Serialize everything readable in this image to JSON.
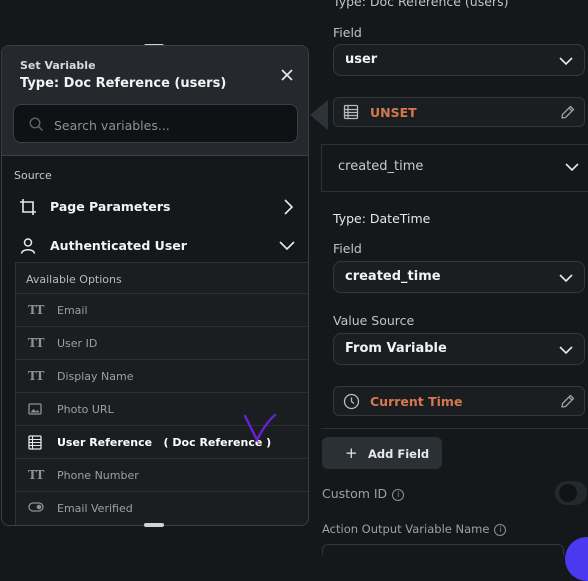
{
  "colors": {
    "accent": "#4b39ef",
    "unset": "#d6784e",
    "bg": "#14181b",
    "panel": "#1a1e21"
  },
  "right_panel": {
    "top_clipped_label": "Type: Doc Reference (users)",
    "field_label_1": "Field",
    "field_value_1": "user",
    "value_1": "UNSET",
    "section_title": "created_time",
    "type_label": "Type: DateTime",
    "field_label_2": "Field",
    "field_value_2": "created_time",
    "value_source_label": "Value Source",
    "value_source": "From Variable",
    "value_2": "Current Time",
    "add_field": "Add Field",
    "custom_id": "Custom ID",
    "action_output": "Action Output Variable Name",
    "icons": [
      "table-icon",
      "clock-icon",
      "edit-icon",
      "chevron-down-icon",
      "plus-icon",
      "info-icon"
    ]
  },
  "popup": {
    "title_small": "Set Variable",
    "title": "Type: Doc Reference (users)",
    "search_placeholder": "Search variables...",
    "source_label": "Source",
    "rows": [
      {
        "label": "Page Parameters",
        "icon": "crop-icon",
        "chevron": "right"
      },
      {
        "label": "Authenticated User",
        "icon": "person-icon",
        "chevron": "down"
      }
    ],
    "available_options_label": "Available Options",
    "options": [
      {
        "label": "Email",
        "icon": "text-type-icon"
      },
      {
        "label": "User ID",
        "icon": "text-type-icon"
      },
      {
        "label": "Display Name",
        "icon": "text-type-icon"
      },
      {
        "label": "Photo URL",
        "icon": "image-icon"
      },
      {
        "label": "User Reference   ( Doc Reference )",
        "icon": "table-icon",
        "selected": true
      },
      {
        "label": "Phone Number",
        "icon": "text-type-icon"
      },
      {
        "label": "Email Verified",
        "icon": "toggle-icon"
      }
    ]
  }
}
